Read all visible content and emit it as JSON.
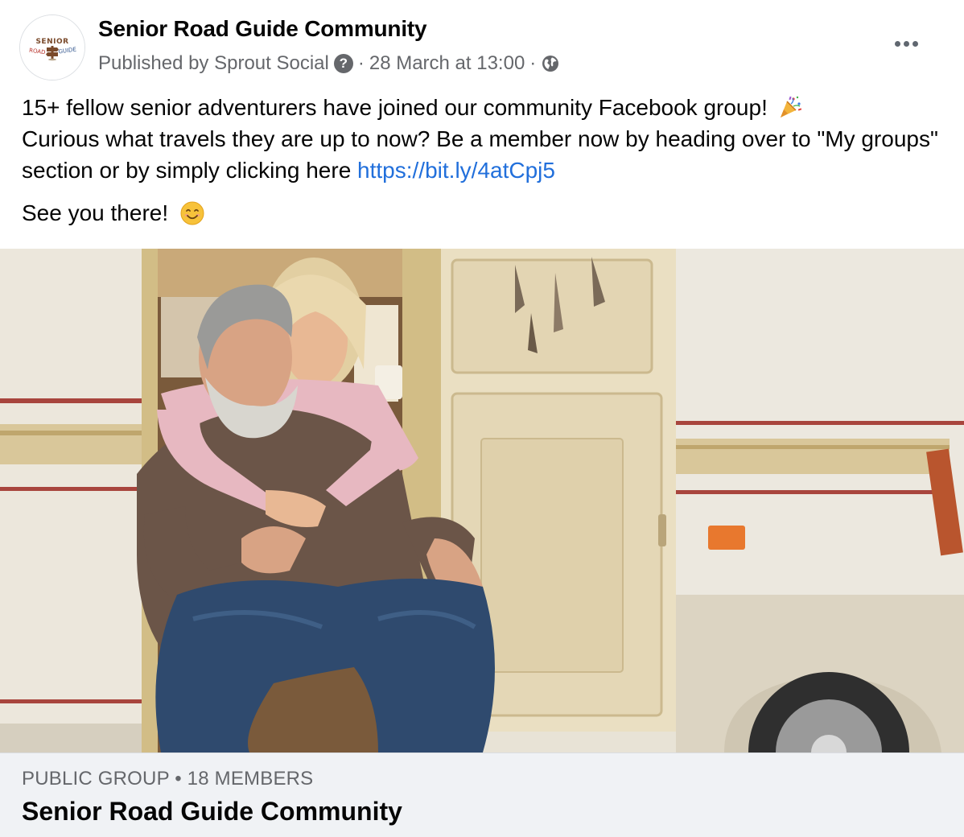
{
  "post": {
    "page_name": "Senior Road Guide Community",
    "published_by": "Published by Sprout Social",
    "help_glyph": "?",
    "separator": "·",
    "timestamp": "28 March at 13:00",
    "privacy_icon": "globe-icon",
    "more_icon": "more-options-icon",
    "avatar_logo": {
      "line1": "SENIOR",
      "left": "ROAD",
      "right": "GUIDE"
    },
    "message": {
      "line1_text": "15+ fellow senior adventurers have joined our community Facebook group! ",
      "line1_emoji": "party-popper-icon",
      "line2_text": "Curious what travels they are up to now? Be a member now by heading over to \"My groups\" section or by simply clicking here ",
      "link_text": "https://bit.ly/4atCpj5",
      "closing_text": "See you there! ",
      "closing_emoji": "smiling-face-icon"
    },
    "image": {
      "subject": "senior-couple-in-camper-doorway"
    },
    "attachment": {
      "meta": "PUBLIC GROUP • 18 MEMBERS",
      "title": "Senior Road Guide Community"
    }
  },
  "colors": {
    "text_primary": "#050505",
    "text_secondary": "#65676b",
    "link": "#216fdb",
    "footer_bg": "#f0f2f5",
    "logo_brown": "#7a4a2b",
    "logo_red": "#b8332b"
  }
}
